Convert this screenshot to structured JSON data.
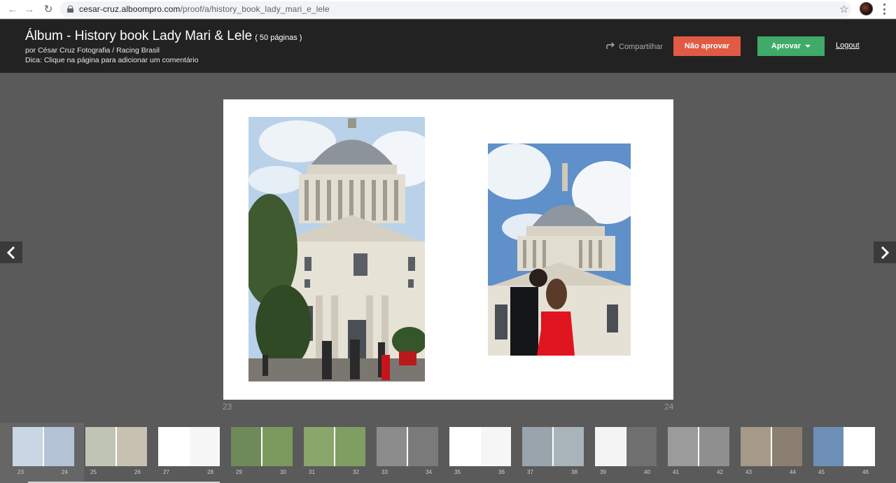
{
  "browser": {
    "url_host": "cesar-cruz.alboompro.com",
    "url_path": "/proof/a/history_book_lady_mari_e_lele"
  },
  "header": {
    "title": "Álbum - History book Lady Mari & Lele",
    "pages_count": "( 50 páginas )",
    "byline": "por César Cruz Fotografia / Racing Brasil",
    "tip": "Dica: Clique na página para adicionar um comentário",
    "share_label": "Compartilhar",
    "reject_label": "Não aprovar",
    "approve_label": "Aprovar",
    "logout_label": "Logout"
  },
  "spread": {
    "left_page": "23",
    "right_page": "24"
  },
  "thumbnails": [
    {
      "left": "23",
      "right": "24",
      "selected": true
    },
    {
      "left": "25",
      "right": "26"
    },
    {
      "left": "27",
      "right": "28"
    },
    {
      "left": "29",
      "right": "30"
    },
    {
      "left": "31",
      "right": "32"
    },
    {
      "left": "33",
      "right": "34"
    },
    {
      "left": "35",
      "right": "36"
    },
    {
      "left": "37",
      "right": "38"
    },
    {
      "left": "39",
      "right": "40"
    },
    {
      "left": "41",
      "right": "42"
    },
    {
      "left": "43",
      "right": "44"
    },
    {
      "left": "45",
      "right": "46"
    }
  ],
  "colors": {
    "header_bg": "#222222",
    "reject": "#e05a44",
    "approve": "#3faa6a",
    "workspace": "#5a5a5a"
  }
}
